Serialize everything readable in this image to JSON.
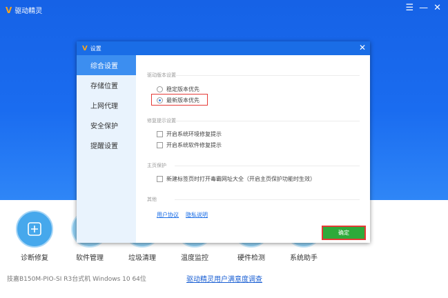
{
  "app": {
    "title": "驱动精灵",
    "logo_glyph": "V",
    "window_controls": {
      "menu": "☰",
      "minimize": "—",
      "close": "✕"
    }
  },
  "tools": [
    {
      "label": "诊断修复",
      "icon": "wrench-icon"
    },
    {
      "label": "软件管理"
    },
    {
      "label": "垃圾清理"
    },
    {
      "label": "温度监控"
    },
    {
      "label": "硬件检测"
    },
    {
      "label": "系统助手"
    }
  ],
  "footer": {
    "system_info": "技嘉B150M-PIO-SI R3台式机    Windows 10 64位",
    "survey_link": "驱动精灵用户满意度调查"
  },
  "dialog": {
    "title": "设置",
    "logo_glyph": "V",
    "close": "✕",
    "sidebar": [
      {
        "label": "综合设置",
        "active": true
      },
      {
        "label": "存储位置"
      },
      {
        "label": "上网代理"
      },
      {
        "label": "安全保护"
      },
      {
        "label": "提醒设置"
      }
    ],
    "sections": {
      "driver_version": {
        "title": "驱动版本设置",
        "options": [
          {
            "label": "稳定版本优先",
            "selected": false
          },
          {
            "label": "最新版本优先",
            "selected": true
          }
        ]
      },
      "repair_prompt": {
        "title": "修复提示设置",
        "options": [
          {
            "label": "开启系统环境修复提示",
            "checked": false
          },
          {
            "label": "开启系统软件修复提示",
            "checked": false
          }
        ]
      },
      "homepage": {
        "title": "主页保护",
        "options": [
          {
            "label": "新建标签页时打开毒霸网址大全（开启主页保护功能时生效）",
            "checked": false
          }
        ]
      },
      "other": {
        "title": "其他",
        "links": [
          "用户协议",
          "隐私说明"
        ]
      }
    },
    "ok_button": "确定"
  },
  "colors": {
    "brand_blue": "#1a6de6",
    "accent_orange": "#f7a520",
    "ok_green": "#2eaa3a",
    "highlight_red": "#e53935"
  }
}
